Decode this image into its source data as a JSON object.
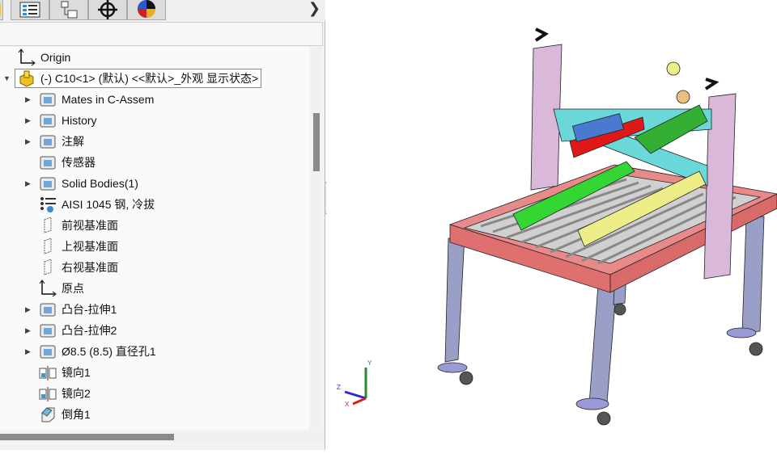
{
  "tabs": [
    {
      "icon": "feature-manager-icon"
    },
    {
      "icon": "property-manager-icon"
    },
    {
      "icon": "configuration-manager-icon"
    },
    {
      "icon": "dimxpert-icon"
    },
    {
      "icon": "display-manager-icon"
    }
  ],
  "tree": {
    "items": [
      {
        "label": "Origin",
        "icon": "origin-icon",
        "expand": false
      },
      {
        "label": "(-) C10<1> (默认) <<默认>_外观 显示状态>",
        "icon": "part-icon",
        "expand": "open"
      },
      {
        "label": "Mates in C-Assem",
        "icon": "mates-folder-icon",
        "expand": true
      },
      {
        "label": "History",
        "icon": "history-icon",
        "expand": true
      },
      {
        "label": "注解",
        "icon": "annotations-icon",
        "expand": true
      },
      {
        "label": "传感器",
        "icon": "sensors-icon",
        "expand": false
      },
      {
        "label": "Solid Bodies(1)",
        "icon": "solid-bodies-icon",
        "expand": true
      },
      {
        "label": "AISI 1045 钢, 冷拔",
        "icon": "material-icon",
        "expand": false
      },
      {
        "label": "前视基准面",
        "icon": "plane-icon",
        "expand": false
      },
      {
        "label": "上视基准面",
        "icon": "plane-icon",
        "expand": false
      },
      {
        "label": "右视基准面",
        "icon": "plane-icon",
        "expand": false
      },
      {
        "label": "原点",
        "icon": "origin-icon",
        "expand": false
      },
      {
        "label": "凸台-拉伸1",
        "icon": "extrude-icon",
        "expand": true
      },
      {
        "label": "凸台-拉伸2",
        "icon": "extrude-icon",
        "expand": true
      },
      {
        "label": "Ø8.5 (8.5) 直径孔1",
        "icon": "hole-wizard-icon",
        "expand": true
      },
      {
        "label": "镜向1",
        "icon": "mirror-icon",
        "expand": false
      },
      {
        "label": "镜向2",
        "icon": "mirror-icon",
        "expand": false
      },
      {
        "label": "倒角1",
        "icon": "chamfer-icon",
        "expand": false
      }
    ]
  },
  "triad": {
    "x": "X",
    "y": "Y",
    "z": "Z"
  },
  "colors": {
    "frame": "#e07a7a",
    "post": "#d9b8d9",
    "leg": "#9a9fc8",
    "rail": "#6ad8d8",
    "green": "#33d633",
    "yellow": "#eeee88",
    "red": "#e01818"
  }
}
